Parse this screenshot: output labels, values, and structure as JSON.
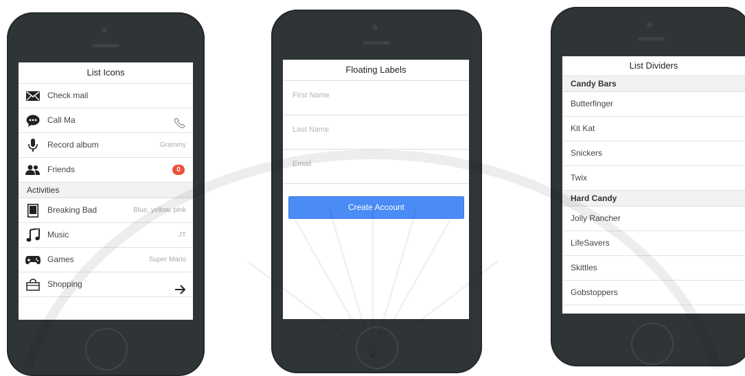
{
  "screens": {
    "list_icons": {
      "title": "List Icons",
      "items": [
        {
          "label": "Check mail",
          "icon": "mail-icon",
          "note": ""
        },
        {
          "label": "Call Ma",
          "icon": "chat-icon",
          "note": ""
        },
        {
          "label": "Record album",
          "icon": "microphone-icon",
          "note": "Grammy"
        },
        {
          "label": "Friends",
          "icon": "people-icon",
          "badge": "0"
        }
      ],
      "divider": "Activities",
      "activities": [
        {
          "label": "Breaking Bad",
          "icon": "tv-icon",
          "note": "Blue, yellow, pink"
        },
        {
          "label": "Music",
          "icon": "music-note-icon",
          "note": "JT"
        },
        {
          "label": "Games",
          "icon": "gamepad-icon",
          "note": "Super Mario"
        },
        {
          "label": "Shopping",
          "icon": "shopping-bag-icon",
          "note": ""
        }
      ],
      "colors": {
        "badge": "#ef4e3a"
      }
    },
    "floating_labels": {
      "title": "Floating Labels",
      "fields": [
        {
          "placeholder": "First Name",
          "value": ""
        },
        {
          "placeholder": "Last Name",
          "value": ""
        },
        {
          "placeholder": "Email",
          "value": ""
        }
      ],
      "button": "Create Account",
      "colors": {
        "button": "#4a8bf5"
      }
    },
    "list_dividers": {
      "title": "List Dividers",
      "groups": [
        {
          "divider": "Candy Bars",
          "items": [
            "Butterfinger",
            "Kit Kat",
            "Snickers",
            "Twix"
          ]
        },
        {
          "divider": "Hard Candy",
          "items": [
            "Jolly Rancher",
            "LifeSavers",
            "Skittles",
            "Gobstoppers"
          ]
        }
      ]
    }
  }
}
